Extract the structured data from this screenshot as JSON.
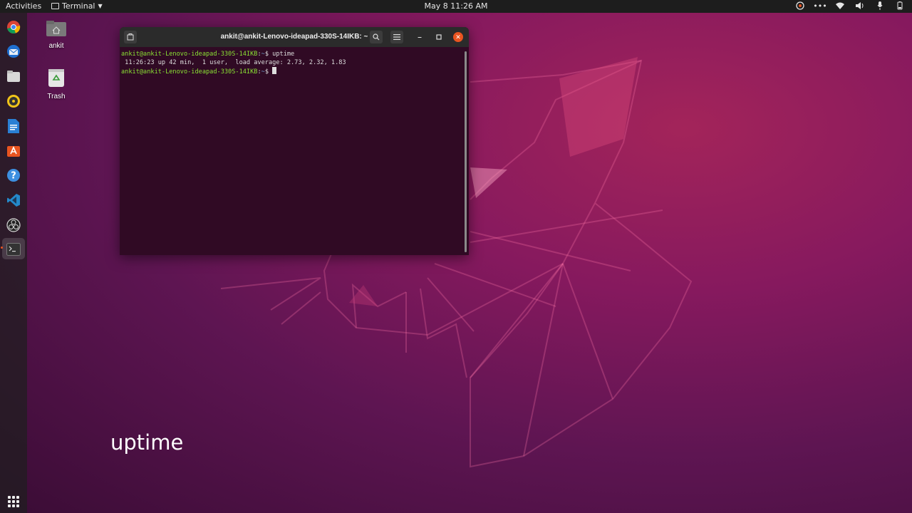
{
  "topbar": {
    "activities": "Activities",
    "app_name": "Terminal",
    "clock": "May 8  11:26 AM",
    "tray_icons": [
      "chrome-remote-icon",
      "more-icon",
      "wifi-icon",
      "volume-icon",
      "microphone-icon",
      "battery-icon"
    ]
  },
  "dock": {
    "items": [
      "chrome-icon",
      "thunderbird-icon",
      "files-icon",
      "rhythmbox-icon",
      "libreoffice-writer-icon",
      "software-center-icon",
      "help-icon",
      "vscode-icon",
      "obs-icon",
      "terminal-icon"
    ],
    "active": "terminal-icon",
    "accent": "#e95420"
  },
  "desktop": {
    "home_label": "ankit",
    "trash_label": "Trash"
  },
  "terminal": {
    "title": "ankit@ankit-Lenovo-ideapad-330S-14IKB: ~",
    "lines": [
      {
        "user": "ankit@ankit-Lenovo-ideapad-330S-14IKB",
        "sep": ":",
        "path": "~",
        "sym": "$ ",
        "cmd": "uptime"
      },
      {
        "output": " 11:26:23 up 42 min,  1 user,  load average: 2.73, 2.32, 1.83"
      },
      {
        "user": "ankit@ankit-Lenovo-ideapad-330S-14IKB",
        "sep": ":",
        "path": "~",
        "sym": "$ ",
        "cmd": ""
      }
    ],
    "colors": {
      "background": "#300a24",
      "prompt_user": "#8ae234",
      "prompt_path": "#729fcf"
    }
  },
  "caption": "uptime"
}
